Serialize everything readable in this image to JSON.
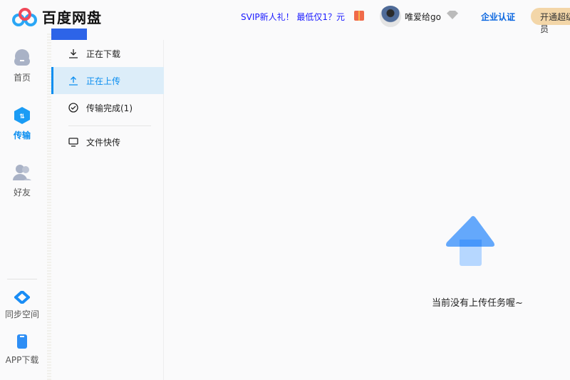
{
  "header": {
    "app_title": "百度网盘",
    "promo": "SVIP新人礼！ 最低仅1？元",
    "username": "唯爱给go",
    "enterprise": "企业认证",
    "open_vip": "开通超级会员"
  },
  "nav": {
    "items": [
      {
        "label": "首页",
        "icon": "cloud-icon"
      },
      {
        "label": "传输",
        "icon": "transfer-icon",
        "active": true
      },
      {
        "label": "好友",
        "icon": "friends-icon"
      },
      {
        "label": "同步空间",
        "icon": "sync-icon"
      },
      {
        "label": "APP下载",
        "icon": "phone-icon"
      }
    ]
  },
  "transfer_panel": {
    "items": [
      {
        "label": "正在下载",
        "icon": "download-icon"
      },
      {
        "label": "正在上传",
        "icon": "upload-icon",
        "active": true
      },
      {
        "label": "传输完成(1)",
        "icon": "check-circle-icon"
      },
      {
        "label": "文件快传",
        "icon": "monitor-icon"
      }
    ]
  },
  "main": {
    "empty_message": "当前没有上传任务喔~"
  },
  "colors": {
    "accent": "#0b8ef0",
    "active_bg": "#dcedf9",
    "arrow": "#64a8fb"
  }
}
